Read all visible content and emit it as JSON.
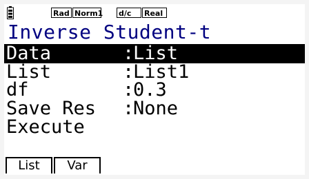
{
  "status_bar": {
    "angle": "Rad",
    "display": "Norm1",
    "fraction": "d/c",
    "complex": "Real"
  },
  "title": "Inverse Student-t",
  "fields": [
    {
      "label": "Data",
      "separator": ":",
      "value": "List",
      "selected": true
    },
    {
      "label": "List",
      "separator": ":",
      "value": "List1",
      "selected": false
    },
    {
      "label": "df",
      "separator": ":",
      "value": "0.3",
      "selected": false
    },
    {
      "label": "Save Res",
      "separator": ":",
      "value": "None",
      "selected": false
    }
  ],
  "execute_label": "Execute",
  "function_keys": [
    {
      "key": "F1",
      "label": "List"
    },
    {
      "key": "F2",
      "label": "Var"
    }
  ],
  "colors": {
    "title": "#000080",
    "selection_bg": "#000000",
    "selection_fg": "#ffffff"
  }
}
